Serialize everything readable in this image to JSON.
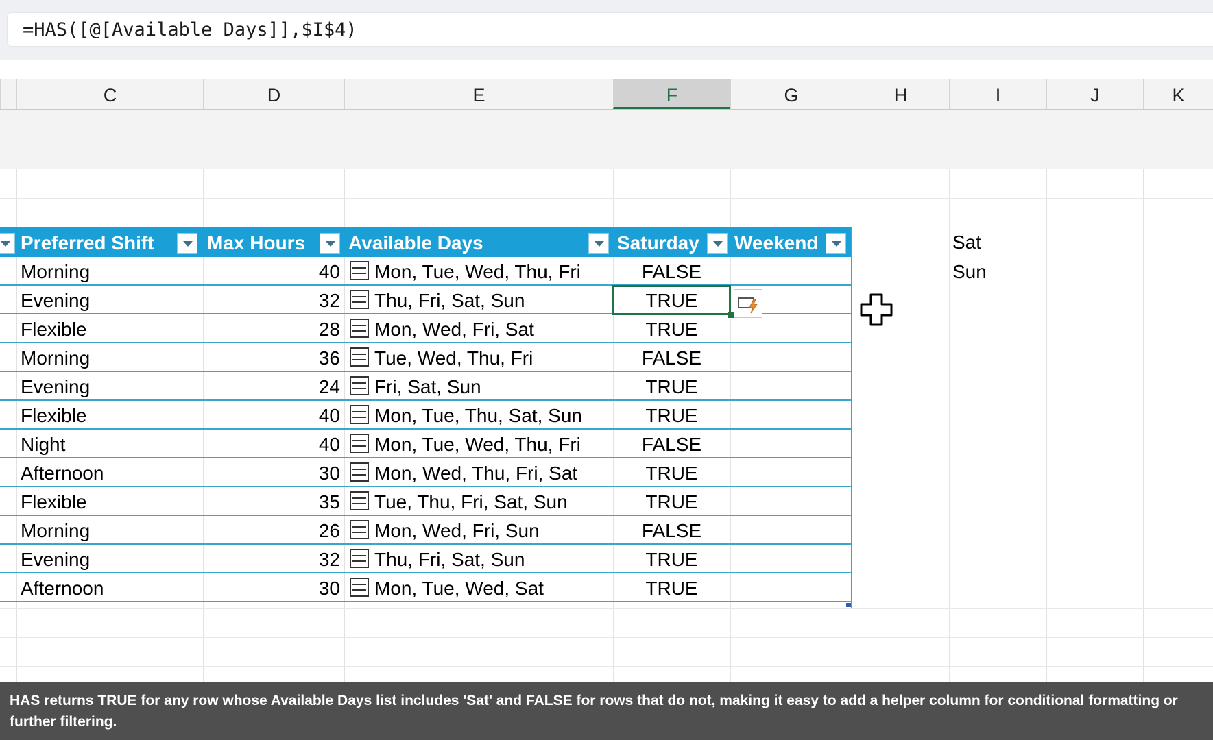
{
  "formula_bar": {
    "text": "=HAS([@[Available Days]],$I$4)"
  },
  "column_headers": [
    "C",
    "D",
    "E",
    "F",
    "G",
    "H",
    "I",
    "J",
    "K"
  ],
  "selected_column": "F",
  "table": {
    "headers": [
      "Preferred Shift",
      "Max Hours",
      "Available Days",
      "Saturday",
      "Weekend"
    ],
    "rows": [
      {
        "shift": "Morning",
        "hours": "40",
        "days": "Mon, Tue, Wed, Thu, Fri",
        "saturday": "FALSE"
      },
      {
        "shift": "Evening",
        "hours": "32",
        "days": "Thu, Fri, Sat, Sun",
        "saturday": "TRUE"
      },
      {
        "shift": "Flexible",
        "hours": "28",
        "days": "Mon, Wed, Fri, Sat",
        "saturday": "TRUE"
      },
      {
        "shift": "Morning",
        "hours": "36",
        "days": "Tue, Wed, Thu, Fri",
        "saturday": "FALSE"
      },
      {
        "shift": "Evening",
        "hours": "24",
        "days": "Fri, Sat, Sun",
        "saturday": "TRUE"
      },
      {
        "shift": "Flexible",
        "hours": "40",
        "days": "Mon, Tue, Thu, Sat, Sun",
        "saturday": "TRUE"
      },
      {
        "shift": "Night",
        "hours": "40",
        "days": "Mon, Tue, Wed, Thu, Fri",
        "saturday": "FALSE"
      },
      {
        "shift": "Afternoon",
        "hours": "30",
        "days": "Mon, Wed, Thu, Fri, Sat",
        "saturday": "TRUE"
      },
      {
        "shift": "Flexible",
        "hours": "35",
        "days": "Tue, Thu, Fri, Sat, Sun",
        "saturday": "TRUE"
      },
      {
        "shift": "Morning",
        "hours": "26",
        "days": "Mon, Wed, Fri, Sun",
        "saturday": "FALSE"
      },
      {
        "shift": "Evening",
        "hours": "32",
        "days": "Thu, Fri, Sat, Sun",
        "saturday": "TRUE"
      },
      {
        "shift": "Afternoon",
        "hours": "30",
        "days": "Mon, Tue, Wed, Sat",
        "saturday": "TRUE"
      }
    ]
  },
  "side_values": {
    "i4": "Sat",
    "i5": "Sun"
  },
  "caption": "HAS returns TRUE for any row whose Available Days list includes 'Sat' and FALSE for rows that do not, making it easy to add a helper column for conditional formatting or further filtering.",
  "colors": {
    "table_header": "#1aa0d6",
    "selection": "#217346",
    "table_border": "#39a6d2"
  }
}
